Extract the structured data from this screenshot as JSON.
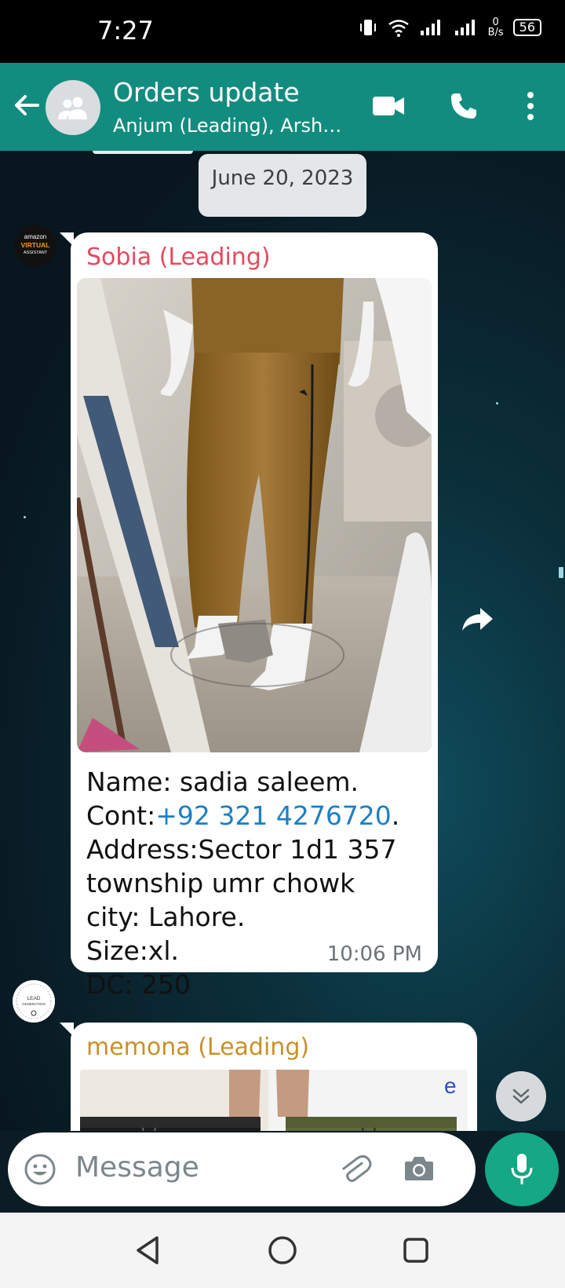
{
  "status_bar": {
    "time": "7:27",
    "net_speed_value": "0",
    "net_speed_unit": "B/s",
    "battery": "56"
  },
  "header": {
    "title": "Orders update",
    "subtitle": "Anjum (Leading), Arshi (..."
  },
  "date_chip": "June 20, 2023",
  "messages": [
    {
      "sender": "Sobia (Leading)",
      "sender_color": "#e5495f",
      "avatar_text": [
        "amazon",
        "VIRTUAL",
        "ASSISTANT"
      ],
      "lines": {
        "name": "Name: sadia saleem.",
        "cont_prefix": "Cont:",
        "phone": "+92 321 4276720",
        "cont_suffix": ".",
        "address1": "Address:Sector 1d1 357",
        "address2": "township umr chowk",
        "city": "city: Lahore.",
        "size": "Size:xl.",
        "dc": "DC: 250"
      },
      "time": "10:06 PM"
    },
    {
      "sender": "memona (Leading)",
      "sender_color": "#c99126",
      "avatar_text": [
        "LEAD",
        "GENERATION"
      ]
    }
  ],
  "input": {
    "placeholder": "Message"
  },
  "colors": {
    "header": "#128c7e",
    "mic": "#14a884",
    "link": "#1d7fc4"
  },
  "icons": [
    "back-arrow-icon",
    "group-icon",
    "video-call-icon",
    "phone-icon",
    "more-vert-icon",
    "forward-icon",
    "chevron-double-down-icon",
    "emoji-icon",
    "attach-icon",
    "camera-icon",
    "mic-icon",
    "nav-back-icon",
    "nav-home-icon",
    "nav-recents-icon"
  ]
}
